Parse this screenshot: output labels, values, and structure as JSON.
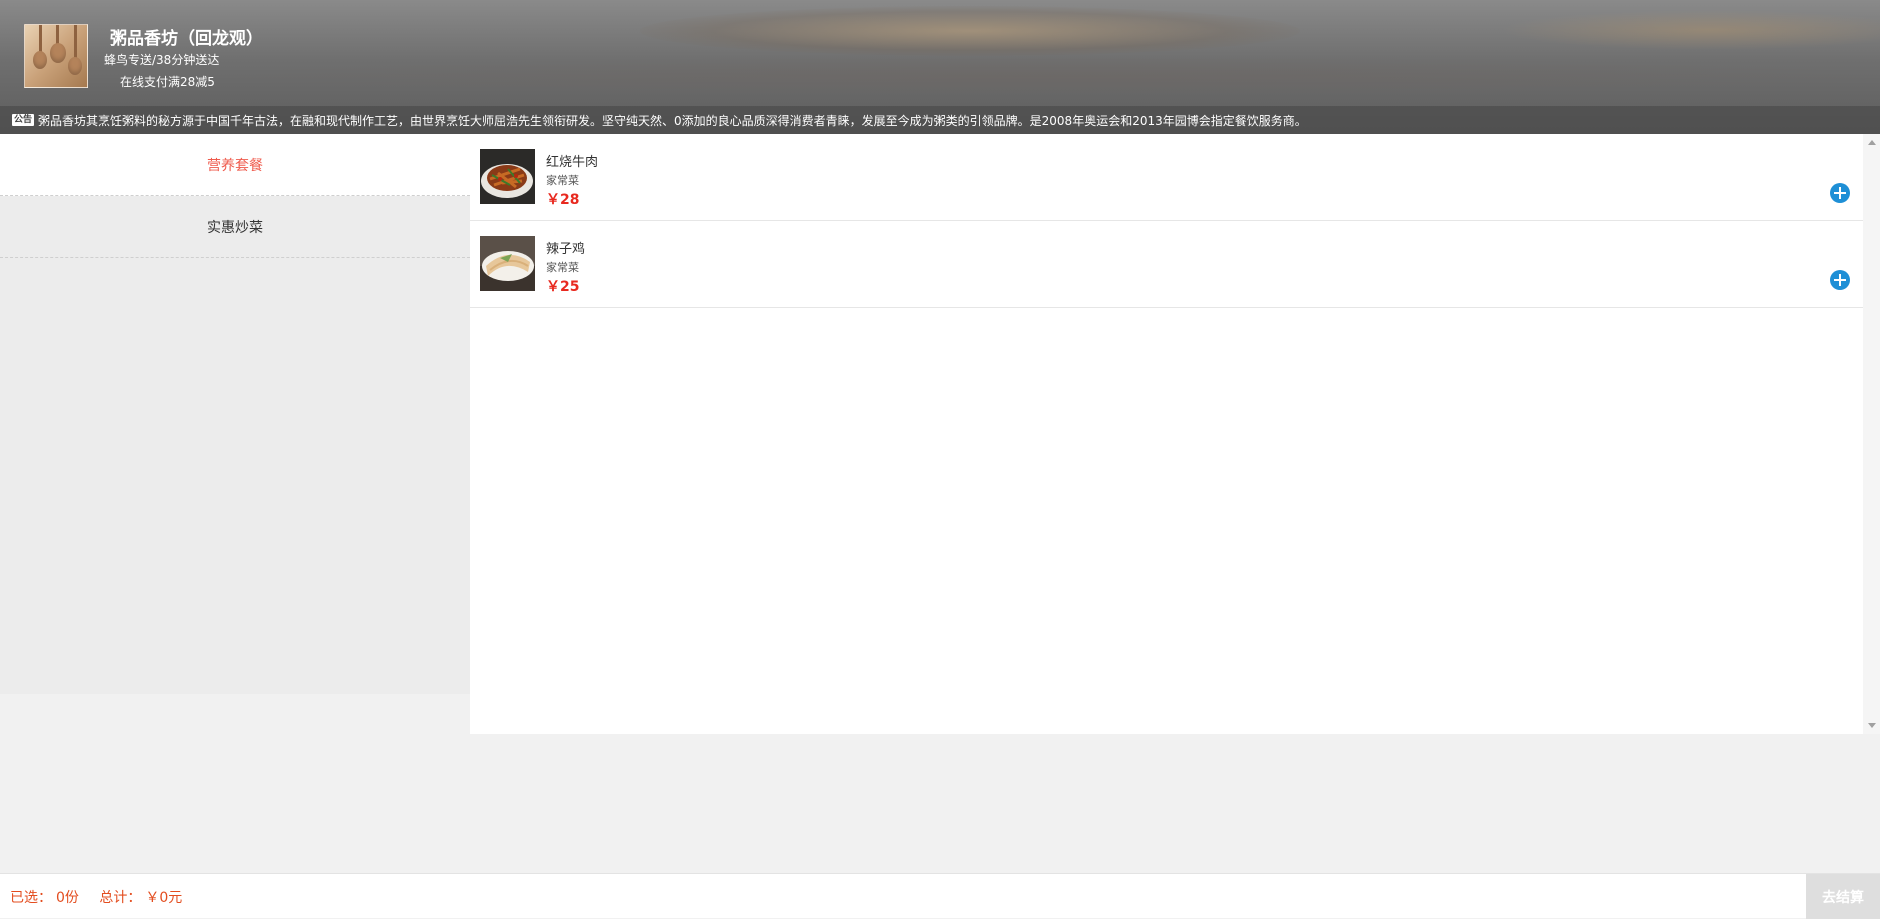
{
  "shop": {
    "name": "粥品香坊（回龙观）",
    "delivery": "蜂鸟专送/38分钟送达",
    "promotion": "在线支付满28减5",
    "notice_badge": "公告",
    "notice": "粥品香坊其烹饪粥料的秘方源于中国千年古法，在融和现代制作工艺，由世界烹饪大师屈浩先生领衔研发。坚守纯天然、0添加的良心品质深得消费者青睐，发展至今成为粥类的引领品牌。是2008年奥运会和2013年园博会指定餐饮服务商。"
  },
  "categories": [
    {
      "label": "营养套餐",
      "active": true
    },
    {
      "label": "实惠炒菜",
      "active": false
    }
  ],
  "products": [
    {
      "name": "红烧牛肉",
      "tag": "家常菜",
      "price": "￥28"
    },
    {
      "name": "辣子鸡",
      "tag": "家常菜",
      "price": "￥25"
    }
  ],
  "cart": {
    "selected_label": "已选：",
    "selected_count": "0份",
    "total_label": "总计：",
    "total_value": "￥0元",
    "checkout_label": "去结算"
  },
  "colors": {
    "accent_red": "#ef5b4d",
    "price_red": "#e8291f",
    "add_button_blue": "#1e8fd6",
    "cart_text": "#e34d1f"
  },
  "icons": {
    "add": "plus-circle-icon",
    "scroll_up": "arrow-up-icon",
    "scroll_down": "arrow-down-icon"
  }
}
